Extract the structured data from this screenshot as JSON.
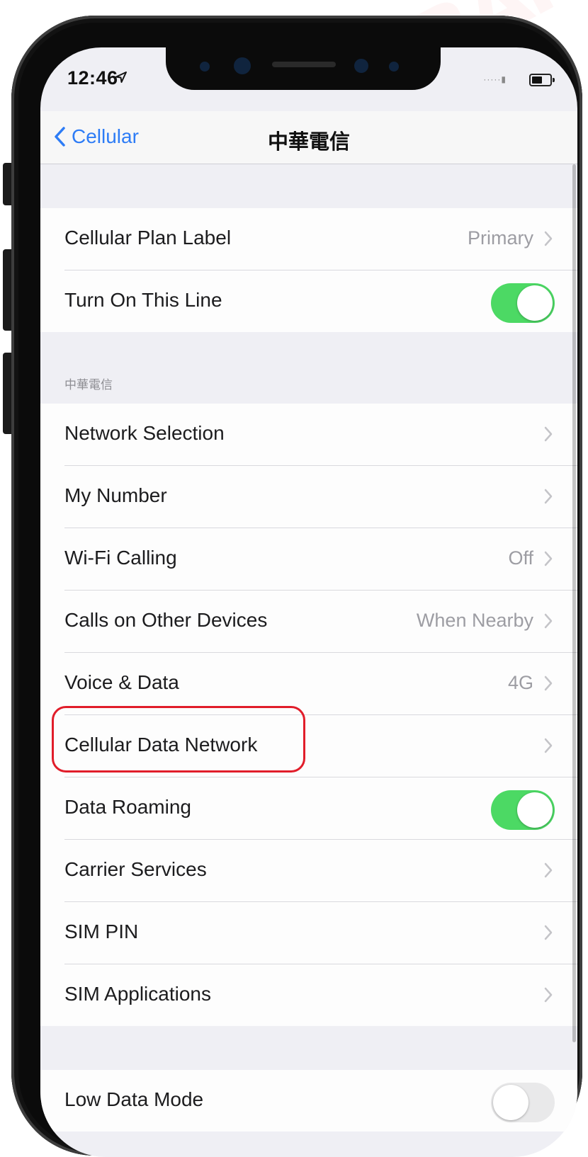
{
  "watermark": "SAMURAI SIM",
  "status_bar": {
    "time": "12:46",
    "icons": [
      "location-arrow-icon",
      "signal-icon",
      "battery-icon"
    ]
  },
  "nav": {
    "back_label": "Cellular",
    "title": "中華電信"
  },
  "plan_group": [
    {
      "label": "Cellular Plan Label",
      "value": "Primary",
      "chevron": true
    },
    {
      "label": "Turn On This Line",
      "toggle": "on"
    }
  ],
  "carrier_section": {
    "header": "中華電信",
    "rows": [
      {
        "label": "Network Selection",
        "value": "",
        "chevron": true
      },
      {
        "label": "My Number",
        "value": "",
        "chevron": true
      },
      {
        "label": "Wi-Fi Calling",
        "value": "Off",
        "chevron": true
      },
      {
        "label": "Calls on Other Devices",
        "value": "When Nearby",
        "chevron": true
      },
      {
        "label": "Voice & Data",
        "value": "4G",
        "chevron": true
      },
      {
        "label": "Cellular Data Network",
        "value": "",
        "chevron": true,
        "highlighted": true
      },
      {
        "label": "Data Roaming",
        "toggle": "on"
      },
      {
        "label": "Carrier Services",
        "value": "",
        "chevron": true
      },
      {
        "label": "SIM PIN",
        "value": "",
        "chevron": true
      },
      {
        "label": "SIM Applications",
        "value": "",
        "chevron": true
      }
    ]
  },
  "low_data_group": [
    {
      "label": "Low Data Mode",
      "toggle": "off"
    }
  ],
  "colors": {
    "accent_blue": "#2d7cf6",
    "toggle_green": "#4cd964",
    "highlight_red": "#e11d2a",
    "grouped_background": "#efeff4"
  }
}
